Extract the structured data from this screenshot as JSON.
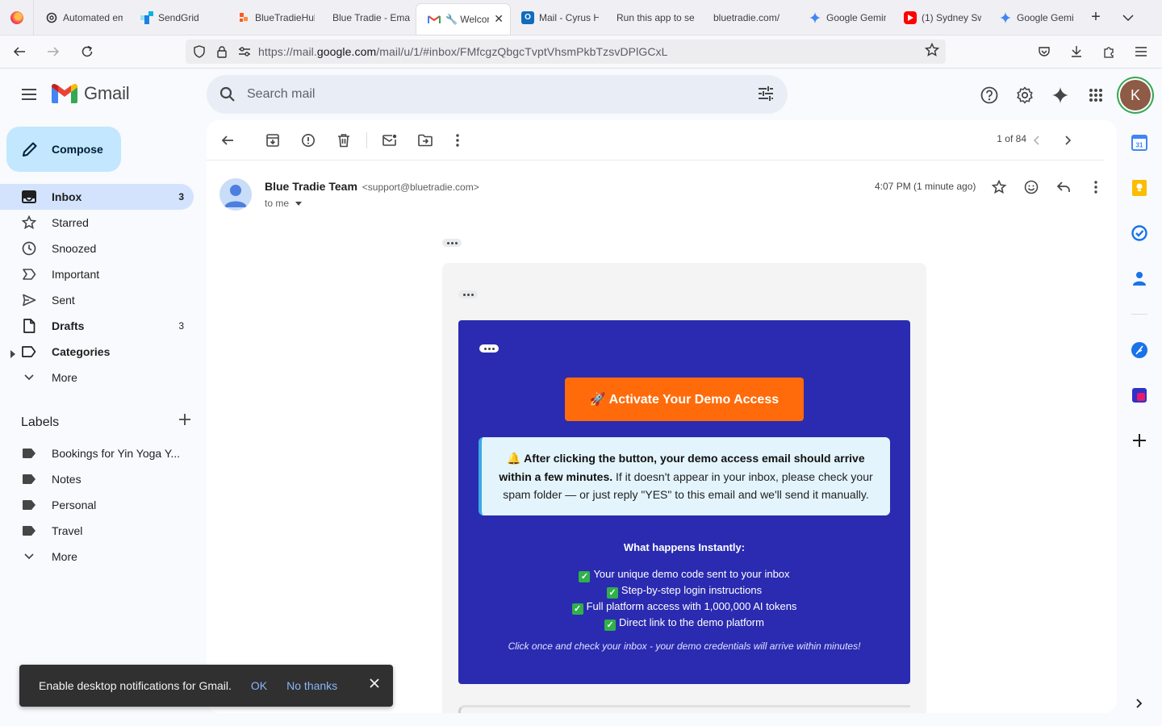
{
  "browser": {
    "tabs": [
      {
        "label": "Automated em",
        "icon": "openai-icon",
        "color": "#333333"
      },
      {
        "label": "SendGrid",
        "icon": "sendgrid-icon",
        "color": "#1a82e2"
      },
      {
        "label": "BlueTradieHub",
        "icon": "bolt-icon",
        "color": "#ff5a1f"
      },
      {
        "label": "Blue Tradie - Emai",
        "icon": "",
        "color": ""
      },
      {
        "label": "🔧 Welcom",
        "icon": "gmail-icon",
        "color": "#ea4335",
        "active": true
      },
      {
        "label": "Mail - Cyrus H",
        "icon": "outlook-icon",
        "color": "#0f6cbd"
      },
      {
        "label": "Run this app to se",
        "icon": "",
        "color": ""
      },
      {
        "label": "bluetradie.com/",
        "icon": "",
        "color": ""
      },
      {
        "label": "Google Gemini",
        "icon": "gemini-icon",
        "color": "#4285f4"
      },
      {
        "label": "(1) Sydney Sw",
        "icon": "youtube-icon",
        "color": "#ff0000"
      },
      {
        "label": "Google Gemini",
        "icon": "gemini-icon",
        "color": "#4285f4"
      }
    ],
    "url": {
      "prefix": "https://mail.",
      "domain": "google.com",
      "path": "/mail/u/1/#inbox/FMfcgzQbgcTvptVhsmPkbTzsvDPlGCxL"
    }
  },
  "gmail": {
    "brand": "Gmail",
    "search_placeholder": "Search mail",
    "avatar_letter": "K",
    "compose_label": "Compose"
  },
  "nav": {
    "items": [
      {
        "label": "Inbox",
        "count": "3",
        "icon": "inbox-icon",
        "active": true
      },
      {
        "label": "Starred",
        "count": "",
        "icon": "star-icon"
      },
      {
        "label": "Snoozed",
        "count": "",
        "icon": "clock-icon"
      },
      {
        "label": "Important",
        "count": "",
        "icon": "important-icon"
      },
      {
        "label": "Sent",
        "count": "",
        "icon": "send-icon"
      },
      {
        "label": "Drafts",
        "count": "3",
        "icon": "draft-icon",
        "bold": true
      },
      {
        "label": "Categories",
        "count": "",
        "icon": "label-outline-icon",
        "bold": true,
        "expandable": true
      },
      {
        "label": "More",
        "count": "",
        "icon": "chevron-down-icon"
      }
    ],
    "labels_title": "Labels",
    "labels": [
      {
        "label": "Bookings for Yin Yoga Y..."
      },
      {
        "label": "Notes"
      },
      {
        "label": "Personal"
      },
      {
        "label": "Travel"
      }
    ],
    "labels_more": "More"
  },
  "toolbar": {
    "pager": "1 of 84"
  },
  "message": {
    "sender_name": "Blue Tradie Team",
    "sender_email": "<support@bluetradie.com>",
    "to": "to me",
    "time": "4:07 PM (1 minute ago)",
    "body": {
      "cta_label": "🚀 Activate Your Demo Access",
      "notice_bold": "🔔 After clicking the button, your demo access email should arrive within a few minutes.",
      "notice_rest": " If it doesn't appear in your inbox, please check your spam folder — or just reply \"YES\" to this email and we'll send it manually.",
      "happens_title": "What happens Instantly:",
      "happens_items": [
        "Your unique demo code sent to your inbox",
        "Step-by-step login instructions",
        "Full platform access with 1,000,000 AI tokens",
        "Direct link to the demo platform"
      ],
      "footer_note": "Click once and check your inbox - your demo credentials will arrive within minutes!",
      "colors": {
        "card": "#2a2bb0",
        "cta": "#ff6b0a",
        "notice_bg": "#e3f4fc",
        "notice_border": "#3ba9e6"
      }
    }
  },
  "snackbar": {
    "text": "Enable desktop notifications for Gmail.",
    "ok": "OK",
    "no_thanks": "No thanks"
  },
  "side_panel": {
    "calendar_day": "31"
  }
}
